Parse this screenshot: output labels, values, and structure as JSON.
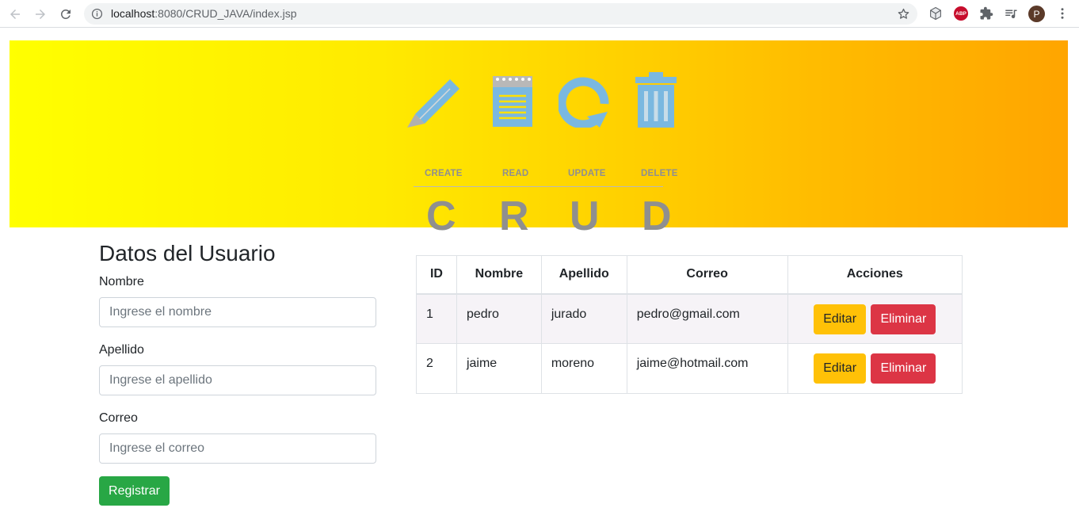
{
  "browser": {
    "url_host": "localhost",
    "url_path": ":8080/CRUD_JAVA/index.jsp",
    "avatar_initial": "P",
    "abp_label": "ABP"
  },
  "banner": {
    "operations": [
      "CREATE",
      "READ",
      "UPDATE",
      "DELETE"
    ],
    "letters": [
      "C",
      "R",
      "U",
      "D"
    ]
  },
  "form": {
    "title": "Datos del Usuario",
    "fields": [
      {
        "label": "Nombre",
        "placeholder": "Ingrese el nombre",
        "value": ""
      },
      {
        "label": "Apellido",
        "placeholder": "Ingrese el apellido",
        "value": ""
      },
      {
        "label": "Correo",
        "placeholder": "Ingrese el correo",
        "value": ""
      }
    ],
    "submit_label": "Registrar"
  },
  "table": {
    "headers": [
      "ID",
      "Nombre",
      "Apellido",
      "Correo",
      "Acciones"
    ],
    "rows": [
      {
        "id": "1",
        "nombre": "pedro",
        "apellido": "jurado",
        "correo": "pedro@gmail.com"
      },
      {
        "id": "2",
        "nombre": "jaime",
        "apellido": "moreno",
        "correo": "jaime@hotmail.com"
      }
    ],
    "edit_label": "Editar",
    "delete_label": "Eliminar"
  },
  "colors": {
    "success": "#28a745",
    "warning": "#ffc107",
    "danger": "#dc3545",
    "banner_start": "#ffff00",
    "banner_end": "#ffa500",
    "icon_blue": "#7ab8e0"
  }
}
